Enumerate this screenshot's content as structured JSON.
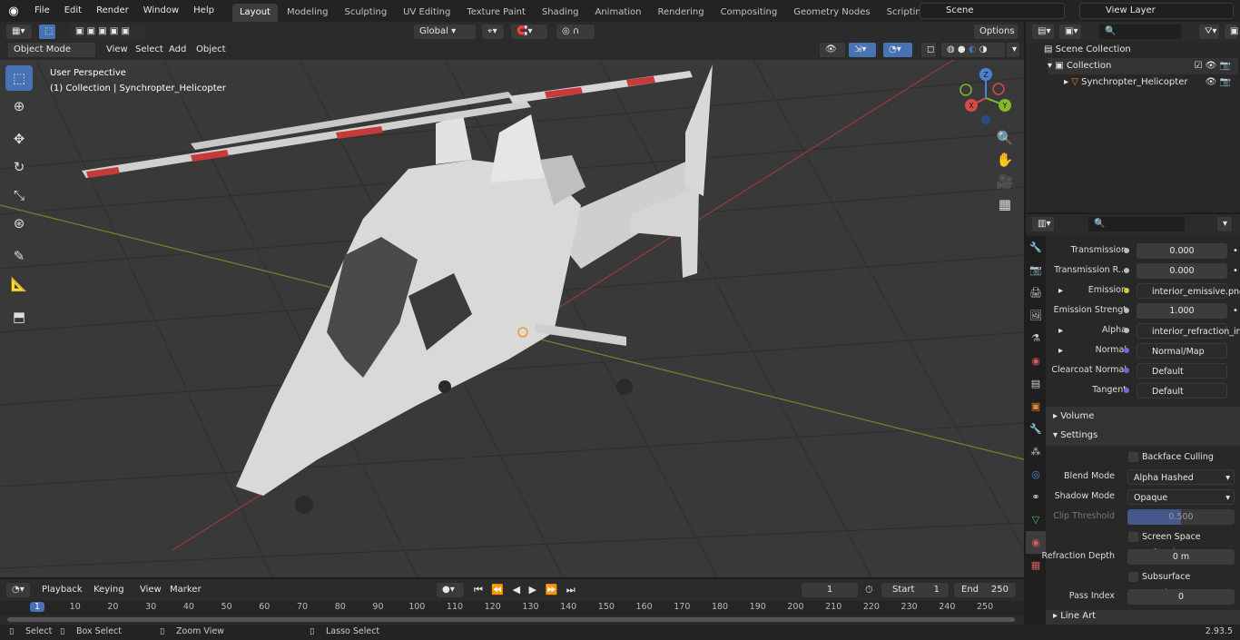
{
  "menu": [
    "File",
    "Edit",
    "Render",
    "Window",
    "Help"
  ],
  "workspaces": [
    "Layout",
    "Modeling",
    "Sculpting",
    "UV Editing",
    "Texture Paint",
    "Shading",
    "Animation",
    "Rendering",
    "Compositing",
    "Geometry Nodes",
    "Scripting"
  ],
  "scene_name": "Scene",
  "view_layer": "View Layer",
  "viewport_header": {
    "orientation": "Global",
    "options": "Options",
    "mode": "Object Mode",
    "menus": [
      "View",
      "Select",
      "Add",
      "Object"
    ]
  },
  "viewport": {
    "perspective": "User Perspective",
    "collection_info": "(1) Collection | Synchropter_Helicopter"
  },
  "gizmo": {
    "z": "Z",
    "y": "Y",
    "x": "X"
  },
  "outliner": {
    "root": "Scene Collection",
    "collection": "Collection",
    "object": "Synchropter_Helicopter"
  },
  "properties": {
    "rows": [
      {
        "label": "Transmission",
        "value": "0.000",
        "kind": "num"
      },
      {
        "label": "Transmission R...",
        "value": "0.000",
        "kind": "num"
      },
      {
        "label": "Emission",
        "value": "interior_emissive.png",
        "kind": "link",
        "dot": "#d6c62a"
      },
      {
        "label": "Emission Strengt",
        "value": "1.000",
        "kind": "num"
      },
      {
        "label": "Alpha",
        "value": "interior_refraction_in...",
        "kind": "link"
      },
      {
        "label": "Normal",
        "value": "Normal/Map",
        "kind": "link",
        "dot": "#6a6ad8"
      },
      {
        "label": "Clearcoat Normal",
        "value": "Default",
        "kind": "link",
        "dot": "#6a6ad8"
      },
      {
        "label": "Tangent",
        "value": "Default",
        "kind": "link",
        "dot": "#6a6ad8"
      }
    ],
    "section_volume": "Volume",
    "section_settings": "Settings",
    "backface": "Backface Culling",
    "blend_label": "Blend Mode",
    "blend_value": "Alpha Hashed",
    "shadow_label": "Shadow Mode",
    "shadow_value": "Opaque",
    "clip_label": "Clip Threshold",
    "clip_value": "0.500",
    "clip_fraction": 0.5,
    "ssr": "Screen Space Refraction",
    "refr_label": "Refraction Depth",
    "refr_value": "0 m",
    "sss": "Subsurface Translucency",
    "pass_label": "Pass Index",
    "pass_value": "0",
    "line_art": "Line Art"
  },
  "timeline": {
    "menus": [
      "Playback",
      "Keying",
      "View",
      "Marker"
    ],
    "current_frame": "1",
    "start_label": "Start",
    "start": "1",
    "end_label": "End",
    "end": "250",
    "ticks": [
      "1",
      "10",
      "20",
      "30",
      "40",
      "50",
      "60",
      "70",
      "80",
      "90",
      "100",
      "110",
      "120",
      "130",
      "140",
      "150",
      "160",
      "170",
      "180",
      "190",
      "200",
      "210",
      "220",
      "230",
      "240",
      "250"
    ]
  },
  "status": {
    "select": "Select",
    "box_select": "Box Select",
    "zoom_view": "Zoom View",
    "lasso_select": "Lasso Select",
    "version": "2.93.5"
  }
}
